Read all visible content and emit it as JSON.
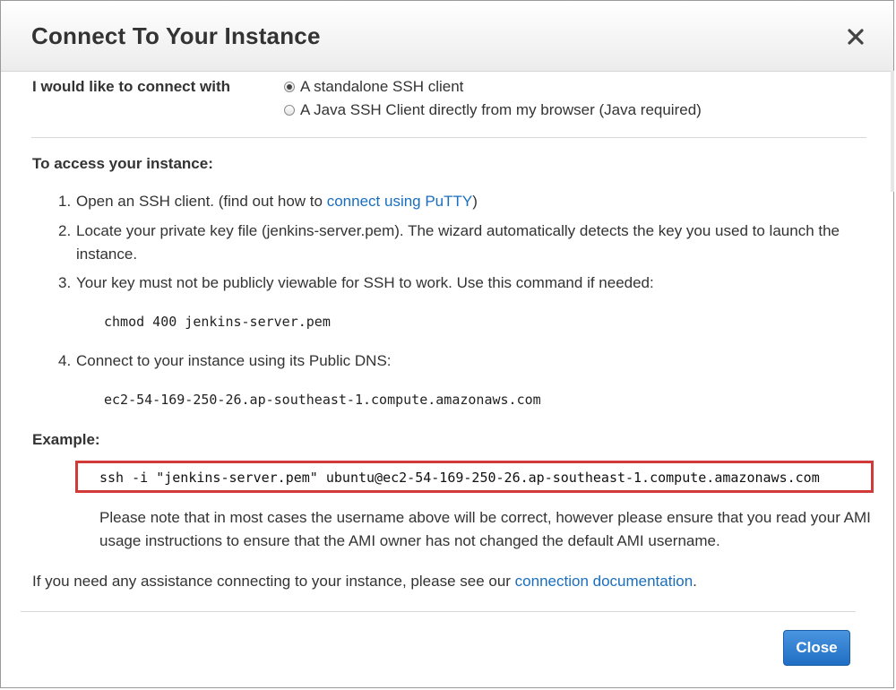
{
  "dialog": {
    "title": "Connect To Your Instance",
    "close_icon": "close-icon"
  },
  "connect": {
    "label": "I would like to connect with",
    "options": [
      {
        "label": "A standalone SSH client",
        "selected": true
      },
      {
        "label": "A Java SSH Client directly from my browser (Java required)",
        "selected": false
      }
    ]
  },
  "access": {
    "heading": "To access your instance:",
    "steps": [
      {
        "num": "1.",
        "text_before": "Open an SSH client. (find out how to ",
        "link": "connect using PuTTY",
        "text_after": ")"
      },
      {
        "num": "2.",
        "text": "Locate your private key file (jenkins-server.pem). The wizard automatically detects the key you used to launch the instance."
      },
      {
        "num": "3.",
        "text": "Your key must not be publicly viewable for SSH to work. Use this command if needed:"
      },
      {
        "num": "4.",
        "text": "Connect to your instance using its Public DNS:"
      }
    ],
    "chmod_command": "chmod 400 jenkins-server.pem",
    "public_dns": "ec2-54-169-250-26.ap-southeast-1.compute.amazonaws.com"
  },
  "example": {
    "heading": "Example:",
    "command": "ssh -i \"jenkins-server.pem\" ubuntu@ec2-54-169-250-26.ap-southeast-1.compute.amazonaws.com",
    "note": "Please note that in most cases the username above will be correct, however please ensure that you read your AMI usage instructions to ensure that the AMI owner has not changed the default AMI username."
  },
  "assistance": {
    "text": "If you need any assistance connecting to your instance, please see our ",
    "link": "connection documentation",
    "text_after": "."
  },
  "footer": {
    "close_label": "Close"
  },
  "colors": {
    "link": "#1a6ebd",
    "primary_button": "#2a7ad0",
    "highlight_border": "#d23a3a"
  }
}
